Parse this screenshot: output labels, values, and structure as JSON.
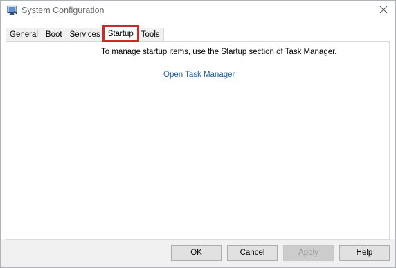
{
  "window": {
    "title": "System Configuration",
    "close_symbol": "✕"
  },
  "tabs": [
    {
      "label": "General"
    },
    {
      "label": "Boot"
    },
    {
      "label": "Services"
    },
    {
      "label": "Startup",
      "active": true
    },
    {
      "label": "Tools"
    }
  ],
  "startup_panel": {
    "message": "To manage startup items, use the Startup section of Task Manager.",
    "link_label": "Open Task Manager"
  },
  "buttons": {
    "ok": "OK",
    "cancel": "Cancel",
    "apply": "Apply",
    "help": "Help"
  },
  "icons": {
    "app": "system-configuration-icon",
    "close": "close-icon"
  },
  "colors": {
    "active_tab_highlight": "#c92a2a",
    "link": "#1a5f9e",
    "footer_bg": "#f0f0f0"
  }
}
